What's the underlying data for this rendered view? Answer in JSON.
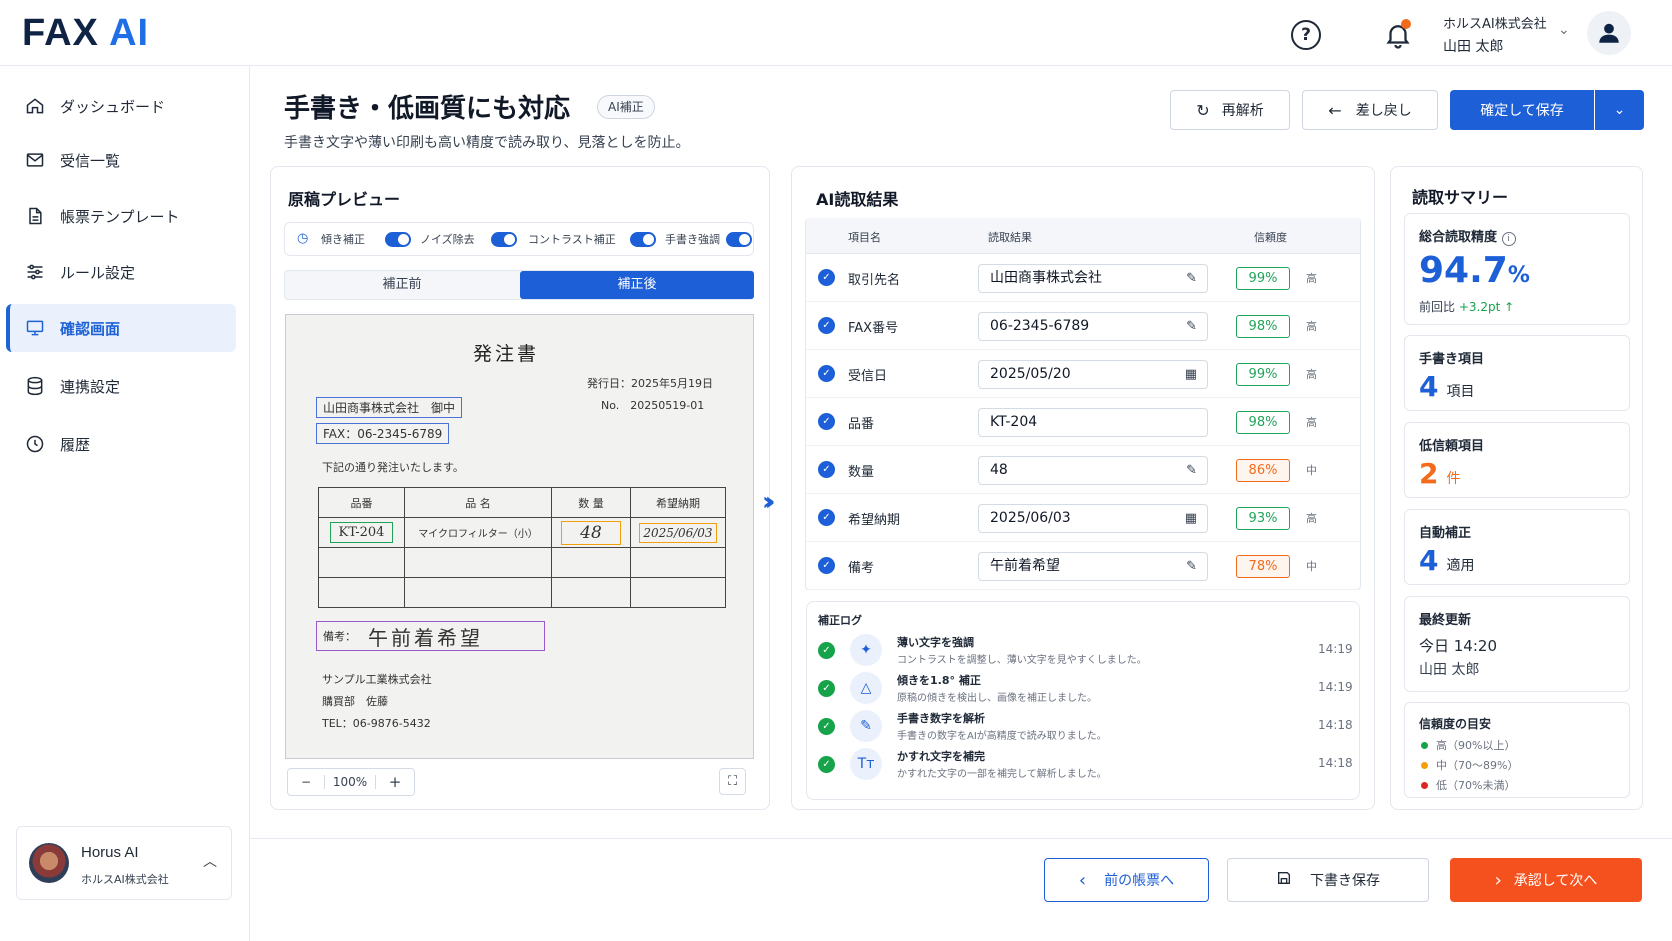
{
  "app": {
    "logo_main": "FAX",
    "logo_ai": "AI",
    "company": "ホルスAI株式会社",
    "user": "山田 太郎"
  },
  "sidebar": {
    "items": [
      {
        "label": "ダッシュボード",
        "icon": "home-icon"
      },
      {
        "label": "受信一覧",
        "icon": "mail-icon"
      },
      {
        "label": "帳票テンプレート",
        "icon": "document-icon"
      },
      {
        "label": "ルール設定",
        "icon": "sliders-icon"
      },
      {
        "label": "確認画面",
        "icon": "monitor-icon",
        "active": true
      },
      {
        "label": "連携設定",
        "icon": "database-icon"
      },
      {
        "label": "履歴",
        "icon": "clock-icon"
      }
    ],
    "user_card": {
      "name": "Horus AI",
      "company": "ホルスAI株式会社"
    }
  },
  "page": {
    "title": "手書き・低画質にも対応",
    "tag": "AI補正",
    "subtitle": "手書き文字や薄い印刷も高い精度で読み取り、見落としを防止。"
  },
  "toolbar": {
    "reanalyze": "再解析",
    "sendback": "差し戻し",
    "confirm_save": "確定して保存"
  },
  "preview": {
    "title": "原稿プレビュー",
    "toggles": [
      "傾き補正",
      "ノイズ除去",
      "コントラスト補正",
      "手書き強調"
    ],
    "seg_before": "補正前",
    "seg_after": "補正後",
    "zoom": "100%",
    "doc": {
      "heading": "発注書",
      "issue_date": "発行日：2025年5月19日",
      "no": "No.　20250519-01",
      "to": "山田商事株式会社　御中",
      "fax": "FAX：06-2345-6789",
      "note": "下記の通り発注いたします。",
      "cols": [
        "品番",
        "品 名",
        "数 量",
        "希望納期"
      ],
      "row": [
        "KT-204",
        "マイクロフィルター（小）",
        "48",
        "2025/06/03"
      ],
      "remarks_label": "備考：",
      "remarks": "午前着希望",
      "sender_company": "サンプル工業株式会社",
      "sender_dept": "購買部　佐藤",
      "sender_tel": "TEL：06-9876-5432"
    }
  },
  "results": {
    "title": "AI読取結果",
    "headers": [
      "項目名",
      "読取結果",
      "信頼度"
    ],
    "rows": [
      {
        "label": "取引先名",
        "value": "山田商事株式会社",
        "conf": "99%",
        "level": "高"
      },
      {
        "label": "FAX番号",
        "value": "06-2345-6789",
        "conf": "98%",
        "level": "高"
      },
      {
        "label": "受信日",
        "value": "2025/05/20",
        "conf": "99%",
        "level": "高"
      },
      {
        "label": "品番",
        "value": "KT-204",
        "conf": "98%",
        "level": "高"
      },
      {
        "label": "数量",
        "value": "48",
        "conf": "86%",
        "level": "中"
      },
      {
        "label": "希望納期",
        "value": "2025/06/03",
        "conf": "93%",
        "level": "高"
      },
      {
        "label": "備考",
        "value": "午前着希望",
        "conf": "78%",
        "level": "中"
      }
    ]
  },
  "log": {
    "title": "補正ログ",
    "items": [
      {
        "title": "薄い文字を強調",
        "desc": "コントラストを調整し、薄い文字を見やすくしました。",
        "time": "14:19"
      },
      {
        "title": "傾きを1.8° 補正",
        "desc": "原稿の傾きを検出し、画像を補正しました。",
        "time": "14:19"
      },
      {
        "title": "手書き数字を解析",
        "desc": "手書きの数字をAIが高精度で読み取りました。",
        "time": "14:18"
      },
      {
        "title": "かすれ文字を補完",
        "desc": "かすれた文字の一部を補完して解析しました。",
        "time": "14:18"
      }
    ]
  },
  "summary": {
    "title": "読取サマリー",
    "accuracy_label": "総合読取精度",
    "accuracy_int": "94.7",
    "accuracy_unit": "%",
    "delta_label": "前回比",
    "delta": "+3.2pt",
    "handwritten_label": "手書き項目",
    "handwritten": "4",
    "handwritten_unit": "項目",
    "lowconf_label": "低信頼項目",
    "lowconf": "2",
    "lowconf_unit": "件",
    "autofix_label": "自動補正",
    "autofix": "4",
    "autofix_unit": "適用",
    "updated_label": "最終更新",
    "updated_time": "今日 14:20",
    "updated_by": "山田 太郎",
    "legend_title": "信頼度の目安",
    "legend": [
      "高（90%以上）",
      "中（70〜89%）",
      "低（70%未満）"
    ],
    "colors": {
      "high": "#16a34a",
      "mid": "#f59e0b",
      "low": "#dc2626"
    }
  },
  "footer": {
    "prev": "前の帳票へ",
    "draft": "下書き保存",
    "approve": "承認して次へ"
  }
}
